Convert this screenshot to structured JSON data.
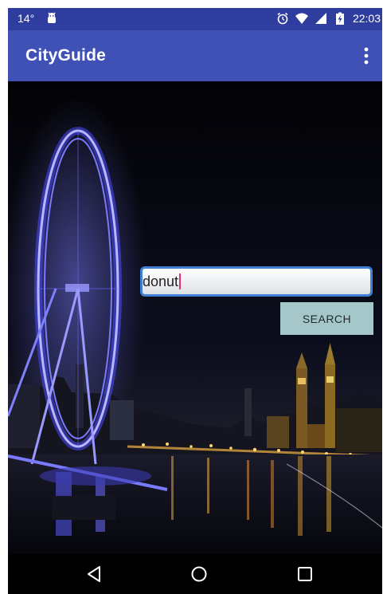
{
  "status_bar": {
    "temperature": "14°",
    "time": "22:03",
    "icons": [
      "weather-temp",
      "android-debug-icon",
      "alarm-icon",
      "wifi-icon",
      "cell-signal-icon",
      "battery-charging-icon"
    ]
  },
  "app_bar": {
    "title": "CityGuide",
    "overflow_icon": "overflow-menu-icon"
  },
  "search": {
    "value": "donut",
    "button_label": "SEARCH"
  },
  "nav_bar": {
    "icons": [
      "back-icon",
      "home-icon",
      "recents-icon"
    ]
  },
  "colors": {
    "status_bar": "#2f3e9e",
    "app_bar": "#3f51b5",
    "field_border": "#3f7fd6",
    "button_bg": "#a6c7c9",
    "caret": "#e0306e"
  }
}
